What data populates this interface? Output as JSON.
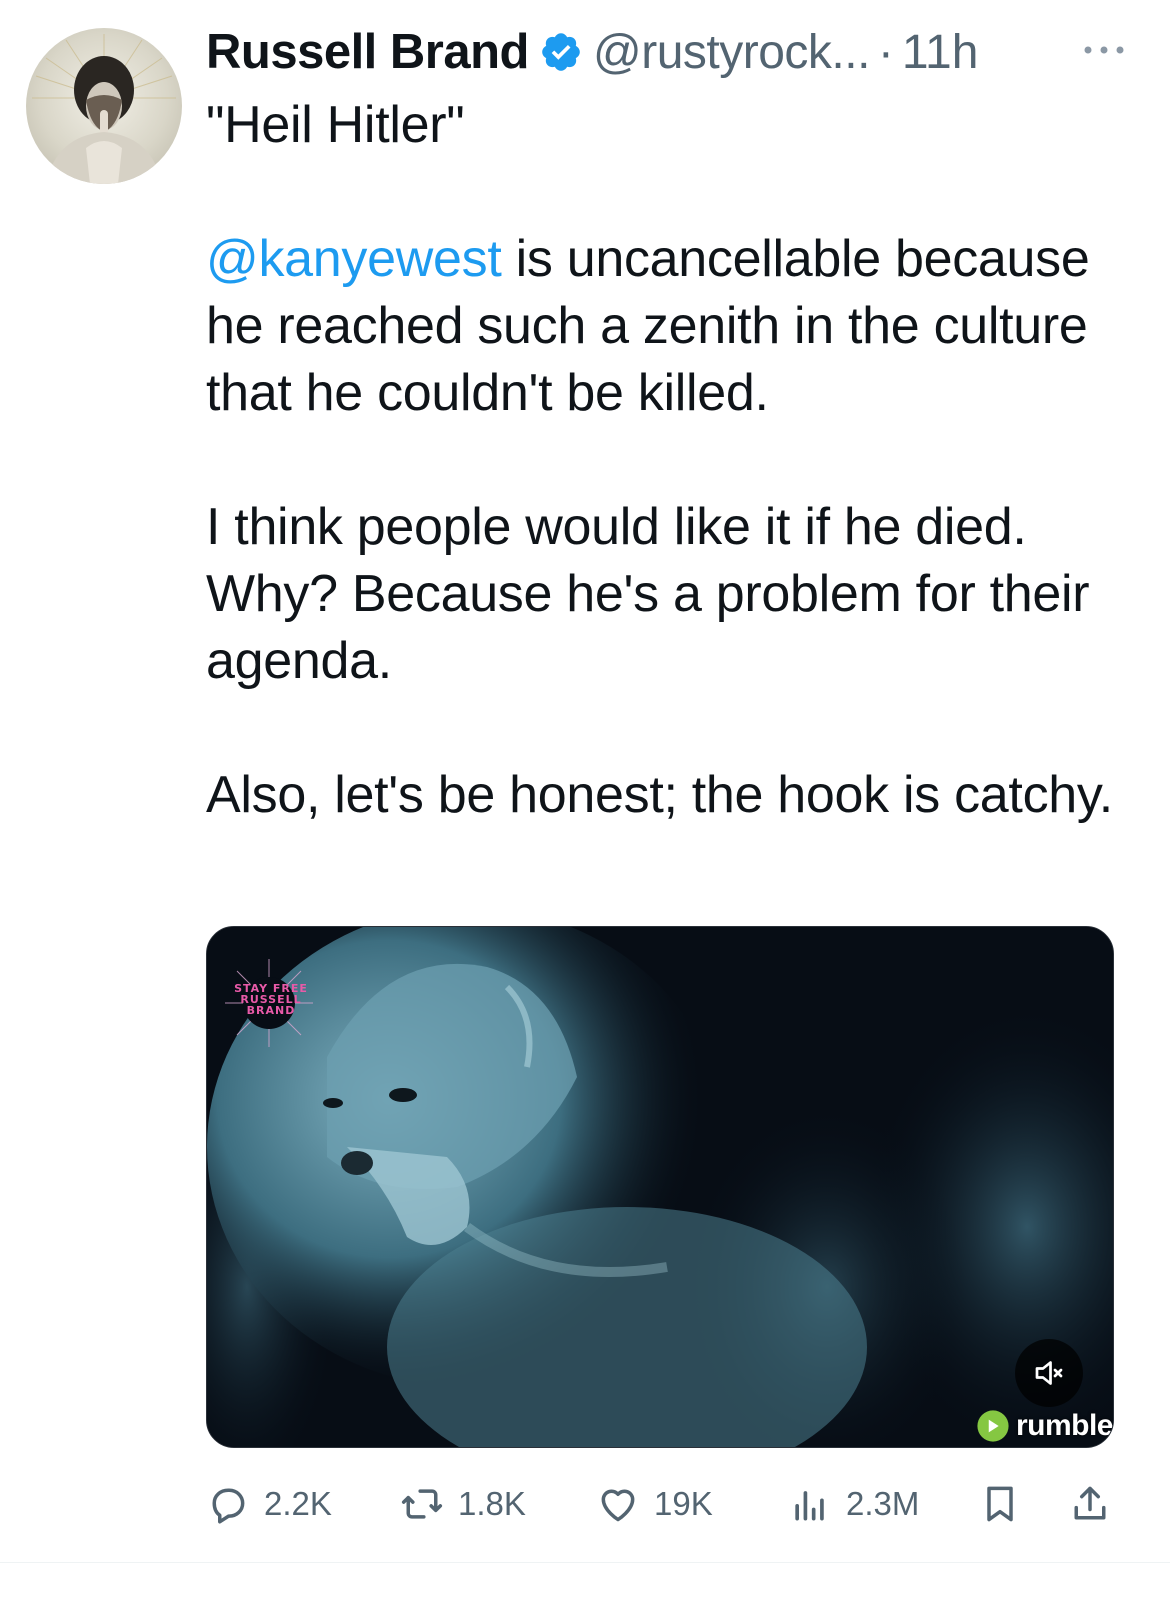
{
  "colors": {
    "accent": "#1d9bf0",
    "text": "#0f1419",
    "secondary": "#536471",
    "rumble_green": "#85c742"
  },
  "tweet": {
    "author": {
      "display_name": "Russell Brand",
      "handle": "@rustyrock...",
      "verified_icon": "verified-badge-icon"
    },
    "separator": "·",
    "time": "11h",
    "more_icon": "more-horizontal-icon",
    "body": {
      "line1": "\"Heil Hitler\"",
      "mention": "@kanyewest",
      "para2_rest": " is uncancellable because he reached such a zenith in the culture that he couldn't be killed.",
      "para3": "I think people would like it if he died. Why? Because he's a problem for their agenda.",
      "para4": "Also, let's be honest; the hook is catchy."
    },
    "media": {
      "watermark": "STAY FREE RUSSELL BRAND",
      "mute_icon": "volume-muted-icon",
      "source_label": "rumble"
    },
    "actions": {
      "replies": "2.2K",
      "reposts": "1.8K",
      "likes": "19K",
      "views": "2.3M"
    }
  }
}
